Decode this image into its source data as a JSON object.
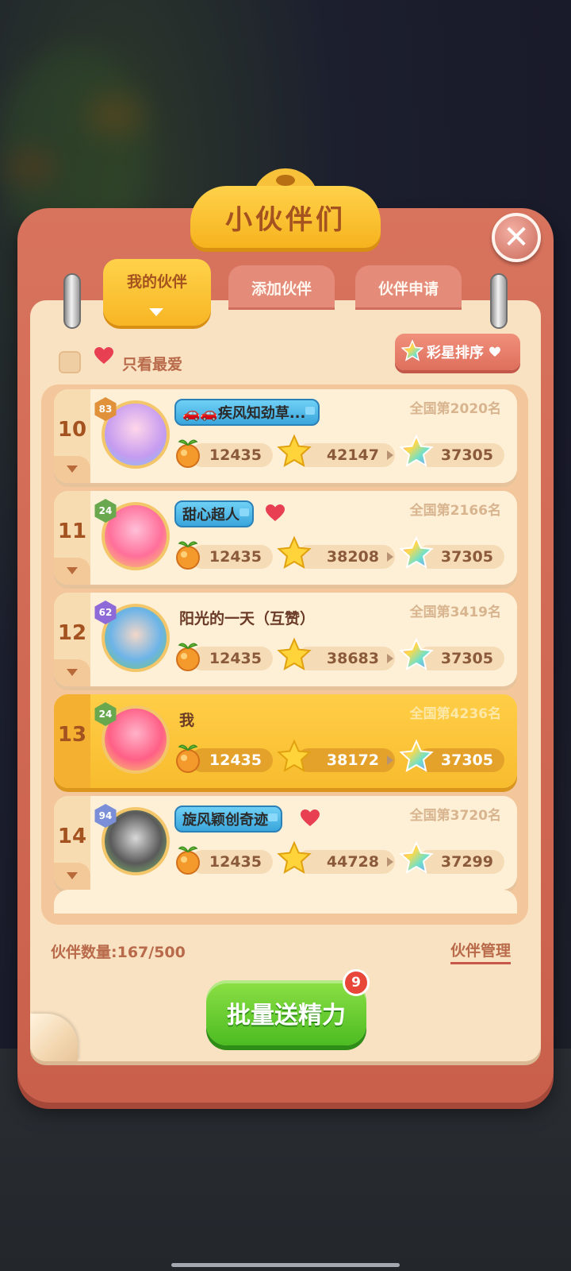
{
  "title": "小伙伴们",
  "tabs": [
    {
      "label": "我的伙伴",
      "active": true
    },
    {
      "label": "添加伙伴",
      "active": false
    },
    {
      "label": "伙伴申请",
      "active": false
    }
  ],
  "filter": {
    "label": "只看最爱",
    "checked": false
  },
  "sort_button": {
    "label": "彩星排序"
  },
  "rows": [
    {
      "rank": "10",
      "level": "83",
      "name": "🚗🚗疾风知劲草...",
      "name_style": "tag",
      "favorite": false,
      "nation_rank": "全国第2020名",
      "energy": "12435",
      "stars": "42147",
      "rainbow": "37305",
      "me": false
    },
    {
      "rank": "11",
      "level": "24",
      "name": "甜心超人",
      "name_style": "tag",
      "favorite": true,
      "nation_rank": "全国第2166名",
      "energy": "12435",
      "stars": "38208",
      "rainbow": "37305",
      "me": false
    },
    {
      "rank": "12",
      "level": "62",
      "name": "阳光的一天（互赞）",
      "name_style": "plain",
      "favorite": false,
      "nation_rank": "全国第3419名",
      "energy": "12435",
      "stars": "38683",
      "rainbow": "37305",
      "me": false
    },
    {
      "rank": "13",
      "level": "24",
      "name": "我",
      "name_style": "plain",
      "favorite": false,
      "nation_rank": "全国第4236名",
      "energy": "12435",
      "stars": "38172",
      "rainbow": "37305",
      "me": true
    },
    {
      "rank": "14",
      "level": "94",
      "name": "旋风颖创奇迹",
      "name_style": "tag",
      "favorite": true,
      "nation_rank": "全国第3720名",
      "energy": "12435",
      "stars": "44728",
      "rainbow": "37299",
      "me": false
    }
  ],
  "footer": {
    "partner_count": "伙伴数量:167/500",
    "manage_link": "伙伴管理",
    "send_button": "批量送精力",
    "send_badge": "9"
  },
  "colors": {
    "board": "#d8735d",
    "paper": "#f9e2c2",
    "title_gold": "#ffd24a",
    "send_green": "#4cbc22",
    "favorite_heart": "#e83f52"
  }
}
